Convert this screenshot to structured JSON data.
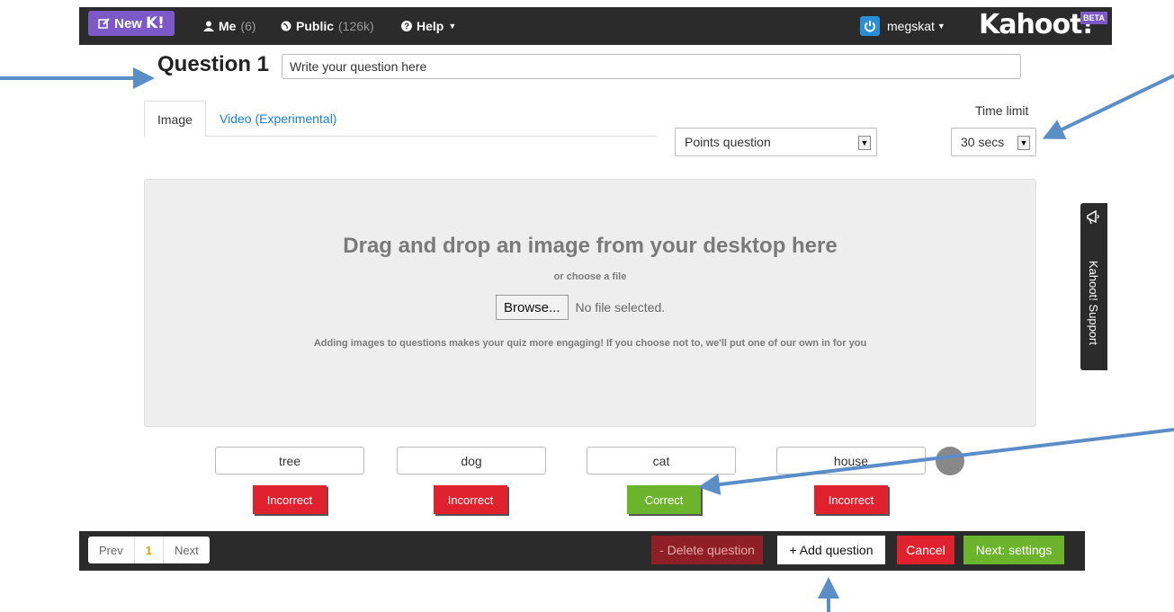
{
  "topbar": {
    "new_label": "New",
    "new_k": "K!",
    "me_label": "Me",
    "me_count": "(6)",
    "public_label": "Public",
    "public_count": "(126k)",
    "help_label": "Help",
    "user_name": "megskat",
    "logo": "Kahoot!",
    "beta": "BETA"
  },
  "question": {
    "label": "Question 1",
    "placeholder": "Write your question here"
  },
  "tabs": [
    {
      "label": "Image",
      "active": true
    },
    {
      "label": "Video (Experimental)",
      "active": false
    }
  ],
  "question_type": {
    "selected": "Points question"
  },
  "time_limit": {
    "label": "Time limit",
    "selected": "30 secs"
  },
  "dropzone": {
    "title": "Drag and drop an image from your desktop here",
    "sub": "or choose a file",
    "browse_label": "Browse...",
    "no_file": "No file selected.",
    "note": "Adding images to questions makes your quiz more engaging! If you choose not to, we'll put one of our own in for you"
  },
  "answers": [
    {
      "text": "tree",
      "status": "Incorrect"
    },
    {
      "text": "dog",
      "status": "Incorrect"
    },
    {
      "text": "cat",
      "status": "Correct"
    },
    {
      "text": "house",
      "status": "Incorrect"
    }
  ],
  "footer": {
    "prev": "Prev",
    "page": "1",
    "next": "Next",
    "delete_label": "- Delete question",
    "add_label": "+ Add question",
    "cancel_label": "Cancel",
    "next_settings_label": "Next: settings"
  },
  "support": {
    "label": "Kahoot! Support"
  },
  "colors": {
    "topbar": "#2b2b2b",
    "brand_purple": "#7d58c7",
    "incorrect_red": "#e0222e",
    "correct_green": "#6bb42c",
    "link_blue": "#1a7fd1",
    "annotation_arrow": "#5b8ec7"
  },
  "icons": [
    "edit-icon",
    "user-icon",
    "globe-icon",
    "help-circle-icon",
    "power-icon",
    "megaphone-icon",
    "caret-down-icon"
  ]
}
